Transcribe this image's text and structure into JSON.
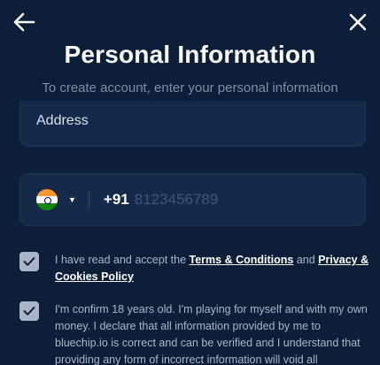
{
  "header": {
    "title": "Personal Information",
    "subtitle": "To create account, enter your personal information",
    "back_icon": "arrow-left-icon",
    "close_icon": "close-icon"
  },
  "address": {
    "placeholder": "Address"
  },
  "phone": {
    "country_flag": "india-flag-icon",
    "dial_code": "+91",
    "placeholder": "8123456789"
  },
  "terms": {
    "checked": true,
    "text_before": "I have read and accept the ",
    "terms_link": "Terms & Conditions",
    "text_middle": " and ",
    "privacy_link": "Privacy & Cookies Policy"
  },
  "age": {
    "checked": true,
    "text": "I'm confirm 18 years old. I'm playing for myself and with my own money. I declare that all information provided by me to bluechip.io is correct and can be verified and I understand that providing any form of incorrect information will void all"
  },
  "colors": {
    "background": "#0d1f38",
    "field": "#152a48",
    "checkbox": "#a9b5c7"
  }
}
